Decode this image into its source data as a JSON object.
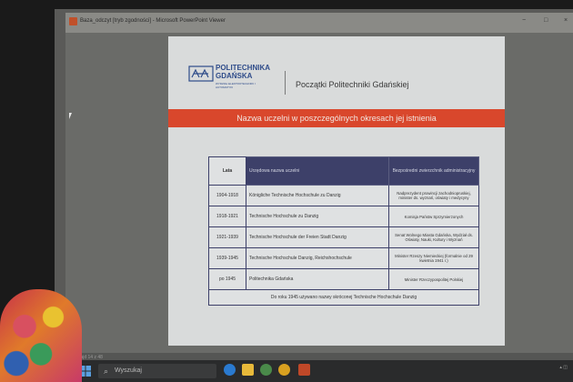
{
  "window": {
    "title": "Baza_odczyt [tryb zgodności] - Microsoft PowerPoint Viewer",
    "controls": [
      "−",
      "□",
      "×"
    ]
  },
  "slide": {
    "logo_line1": "POLITECHNIKA",
    "logo_line2": "GDAŃSKA",
    "logo_sub": "WYDZIAŁ ELEKTROTECHNIKI I AUTOMATYKI",
    "heading": "Początki Politechniki Gdańskiej",
    "banner": "Nazwa uczelni w poszczególnych okresach jej istnienia",
    "table": {
      "headers": [
        "Lata",
        "Urzędowa nazwa uczelni",
        "Bezpośredni zwierzchnik administracyjny"
      ],
      "rows": [
        [
          "1904-1918",
          "Königliche Technische Hochschule zu Danzig",
          "Nadprezydent prowincji zachodniopruskiej, minister ds. wyznań, oświaty i medycyny"
        ],
        [
          "1918-1921",
          "Technische Hochschule zu Danzig",
          "Komisja Państw Sprzymierzonych"
        ],
        [
          "1921-1939",
          "Technische Hochschule der Freien Stadt Danzig",
          "Senat Wolnego Miasta Gdańska, Wydział ds. Oświaty, Nauki, Kultury i Wyznań"
        ],
        [
          "1939-1945",
          "Technische Hochschule Danzig, Reichshochschule",
          "Minister Rzeszy Niemieckiej (formalnie od 29 kwietnia 1941 r.)"
        ],
        [
          "po 1945",
          "Politechnika Gdańska",
          "Minister Rzeczypospolitej Polskiej"
        ]
      ],
      "footnote": "Do roku 1945 używano nazwy skróconej Technische Hochschule Danzig"
    }
  },
  "status": {
    "slide_info": "Slajd 14 z 48"
  },
  "taskbar": {
    "search_placeholder": "Wyszukaj"
  },
  "colors": {
    "banner": "#d9472c",
    "table_header": "#3d4069",
    "logo": "#2f4c8a"
  }
}
